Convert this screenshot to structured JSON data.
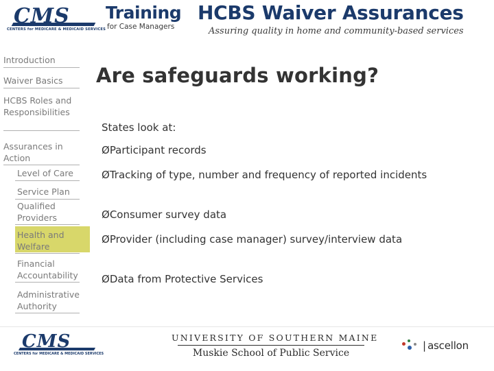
{
  "header": {
    "cms_logo_text": "CMS",
    "cms_logo_subtext": "CENTERS for MEDICARE & MEDICAID SERVICES",
    "training_word": "Training",
    "training_subtext": "for Case Managers",
    "title": "HCBS Waiver Assurances",
    "subtitle": "Assuring quality in home and community-based services"
  },
  "sidebar": {
    "items": [
      {
        "label": "Introduction",
        "selected": false,
        "indented": false
      },
      {
        "label": "Waiver Basics",
        "selected": false,
        "indented": false
      },
      {
        "label": "HCBS Roles and Responsibilities",
        "selected": false,
        "indented": false
      },
      {
        "label": "Assurances in Action",
        "selected": false,
        "indented": false
      },
      {
        "label": "Level of Care",
        "selected": false,
        "indented": true
      },
      {
        "label": "Service Plan",
        "selected": false,
        "indented": true
      },
      {
        "label": "Qualified Providers",
        "selected": false,
        "indented": true
      },
      {
        "label": "Health and Welfare",
        "selected": true,
        "indented": true
      },
      {
        "label": "Financial Accountability",
        "selected": false,
        "indented": true
      },
      {
        "label": "Administrative Authority",
        "selected": false,
        "indented": true
      }
    ]
  },
  "main": {
    "title": "Are safeguards working?",
    "intro": "States look at:",
    "bullet_marker": "Ø",
    "bullets": [
      "Participant records",
      "Tracking of type, number and frequency of reported incidents",
      "Consumer survey data",
      "Provider (including case manager) survey/interview data",
      "Data from Protective Services"
    ]
  },
  "footer": {
    "cms_logo_text": "CMS",
    "cms_logo_subtext": "CENTERS for MEDICARE & MEDICAID SERVICES",
    "university_line1": "UNIVERSITY OF SOUTHERN MAINE",
    "university_line2": "Muskie School of Public Service",
    "partner_name": "ascellon",
    "partner_separator": "|"
  },
  "colors": {
    "brand_blue": "#1b3a6b",
    "highlight": "#d8d76a",
    "nav_text": "#7a7a7a",
    "body_text": "#333333"
  }
}
